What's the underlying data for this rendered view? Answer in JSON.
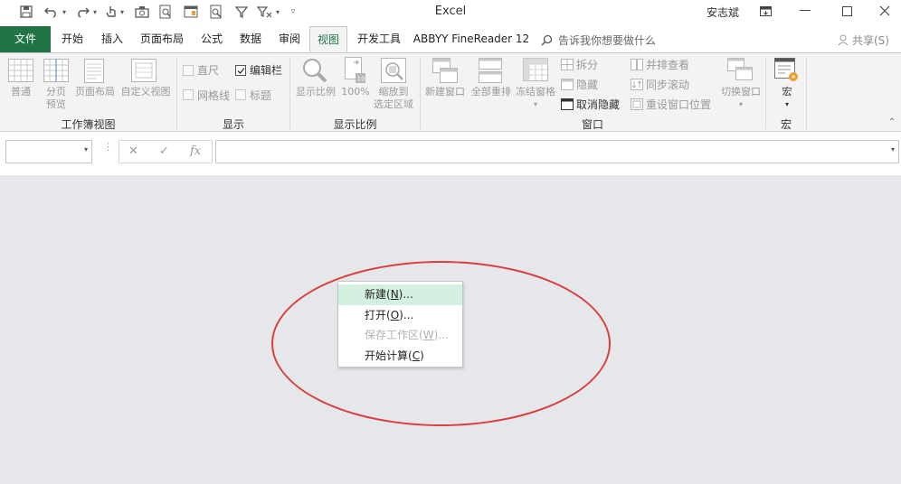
{
  "window": {
    "title": "Excel",
    "user": "安志斌"
  },
  "tabs": [
    {
      "label": "文件"
    },
    {
      "label": "开始"
    },
    {
      "label": "插入"
    },
    {
      "label": "页面布局"
    },
    {
      "label": "公式"
    },
    {
      "label": "数据"
    },
    {
      "label": "审阅"
    },
    {
      "label": "视图"
    },
    {
      "label": "开发工具"
    },
    {
      "label": "ABBYY FineReader 12"
    }
  ],
  "tell_me": "告诉我你想要做什么",
  "share": "共享(S)",
  "ribbon": {
    "workbook_views": {
      "group": "工作簿视图",
      "normal": "普通",
      "page_break_1": "分页",
      "page_break_2": "预览",
      "page_layout": "页面布局",
      "custom_views": "自定义视图"
    },
    "show": {
      "group": "显示",
      "ruler": "直尺",
      "formula_bar": "编辑栏",
      "gridlines": "网格线",
      "headings": "标题"
    },
    "zoom": {
      "group": "显示比例",
      "zoom": "显示比例",
      "zoom_100": "100%",
      "zoom_sel_1": "缩放到",
      "zoom_sel_2": "选定区域"
    },
    "window": {
      "group": "窗口",
      "new_window": "新建窗口",
      "arrange_all": "全部重排",
      "freeze_panes": "冻结窗格",
      "split": "拆分",
      "hide": "隐藏",
      "unhide": "取消隐藏",
      "side_by_side": "并排查看",
      "sync_scroll": "同步滚动",
      "reset_pos": "重设窗口位置",
      "switch_windows": "切换窗口"
    },
    "macros": {
      "group": "宏",
      "macros": "宏"
    }
  },
  "formula_bar": {
    "cancel": "✕",
    "enter": "✓",
    "fx": "fx"
  },
  "context_menu": {
    "items": [
      {
        "label": "新建(",
        "key": "N",
        "suffix": ")..."
      },
      {
        "label": "打开(",
        "key": "O",
        "suffix": ")..."
      },
      {
        "label": "保存工作区(",
        "key": "W",
        "suffix": ")..."
      },
      {
        "label": "开始计算(",
        "key": "C",
        "suffix": ")"
      }
    ]
  },
  "colors": {
    "accent": "#217346",
    "menu_hover": "#d3f0e0",
    "highlight_ellipse": "#d9403c",
    "workspace": "#e6e7ea"
  }
}
